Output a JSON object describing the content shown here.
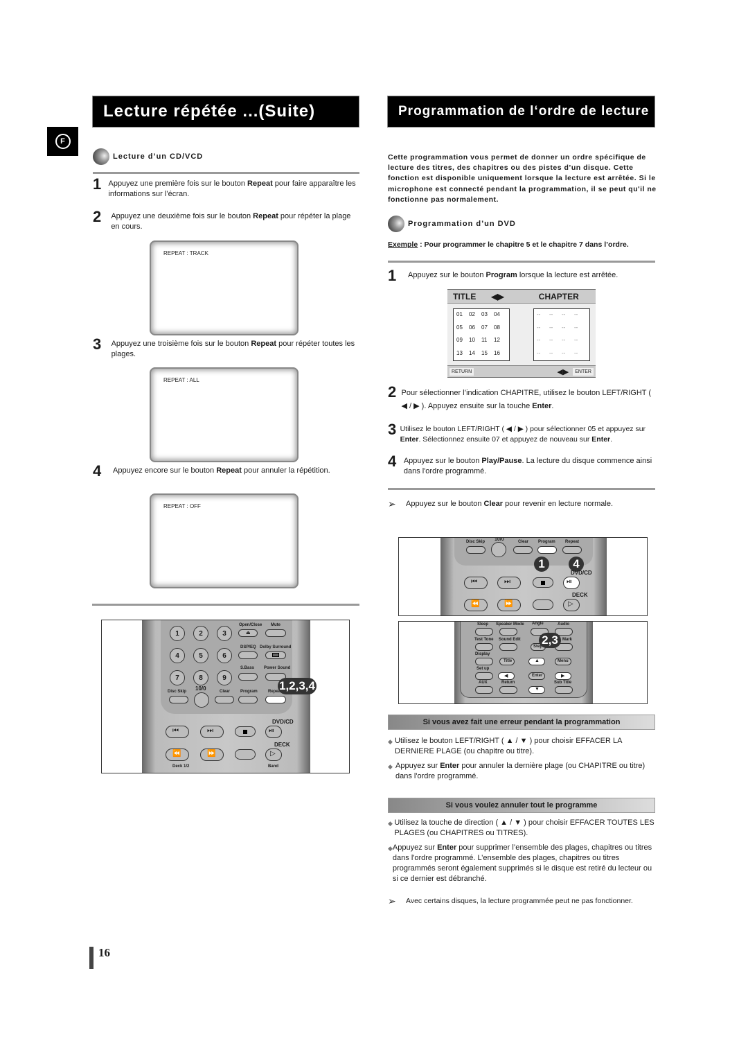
{
  "left": {
    "title": "Lecture répétée ...(Suite)",
    "lang_badge": "F",
    "subhead": "Lecture d’un CD/VCD",
    "steps": [
      {
        "num": "1",
        "pre": "Appuyez une première fois sur le bouton ",
        "bold": "Repeat",
        "post": " pour faire apparaître les informations sur l’écran."
      },
      {
        "num": "2",
        "pre": "Appuyez une deuxième fois sur le bouton ",
        "bold": "Repeat",
        "post": " pour répéter la plage en cours."
      },
      {
        "num": "3",
        "pre": "Appuyez une troisième fois sur le bouton ",
        "bold": "Repeat",
        "post": " pour répéter toutes les plages."
      },
      {
        "num": "4",
        "pre": "Appuyez encore sur le bouton ",
        "bold": "Repeat",
        "post": " pour annuler la répétition."
      }
    ],
    "screens": [
      "REPEAT : TRACK",
      "REPEAT : ALL",
      "REPEAT : OFF"
    ],
    "remote": {
      "numbers": [
        "1",
        "2",
        "3",
        "4",
        "5",
        "6",
        "7",
        "8",
        "9"
      ],
      "labels": {
        "open_close": "Open/Close",
        "mute": "Mute",
        "dsp_eq": "DSP/EQ",
        "dolby": "Dolby Surround",
        "sbass": "S.Bass",
        "power_sound": "Power Sound",
        "disc_skip": "Disc Skip",
        "ten": "10/0",
        "clear": "Clear",
        "program": "Program",
        "repeat": "Repeat",
        "dvd_cd": "DVD/CD",
        "deck": "DECK",
        "deck12": "Deck 1/2",
        "band": "Band"
      },
      "badge": "1,2,3,4"
    }
  },
  "right": {
    "title": "Programmation de l‘ordre de lecture",
    "intro": "Cette programmation vous permet de donner un ordre spécifique de lecture des titres, des chapitres ou des pistes d’un disque. Cette fonction est disponible uniquement lorsque la lecture est arrêtée. Si le microphone est connecté pendant la programmation, il se peut qu'il ne fonctionne pas normalement.",
    "subhead": "Programmation d’un DVD",
    "example_label": "Exemple",
    "example_text": " : Pour programmer le chapitre 5 et le chapitre 7 dans l’ordre.",
    "step1": {
      "num": "1",
      "pre": "Appuyez sur le bouton ",
      "bold": "Program",
      "post": " lorsque la lecture est arrêtée."
    },
    "menu": {
      "title": "TITLE",
      "chapter": "CHAPTER",
      "arrows": "◀▶",
      "titles": [
        "01",
        "02",
        "03",
        "04",
        "05",
        "06",
        "07",
        "08",
        "09",
        "10",
        "11",
        "12",
        "13",
        "14",
        "15",
        "16"
      ],
      "chapters": [
        "--",
        "--",
        "--",
        "--",
        "--",
        "--",
        "--",
        "--",
        "--",
        "--",
        "--",
        "--",
        "--",
        "--",
        "--",
        "--"
      ],
      "return": "RETURN",
      "enter": "ENTER"
    },
    "step2": {
      "num": "2",
      "a": "Pour sélectionner l’indication CHAPITRE, utilisez le bouton LEFT/RIGHT ( ◀ / ▶ ). Appuyez ensuite sur la touche ",
      "b": "Enter",
      "c": "."
    },
    "step3": {
      "num": "3",
      "a": "Utilisez le bouton LEFT/RIGHT ( ◀ / ▶ ) pour sélectionner 05 et appuyez sur ",
      "b": "Enter",
      "c": ". Sélectionnez ensuite 07 et appuyez de nouveau sur ",
      "d": "Enter",
      "e": "."
    },
    "step4": {
      "num": "4",
      "a": "Appuyez sur le bouton ",
      "b": "Play/Pause",
      "c": ". La lecture du disque commence ainsi dans l'ordre programmé."
    },
    "note1": {
      "a": "Appuyez sur le bouton ",
      "b": "Clear",
      "c": " pour revenir en lecture normale."
    },
    "remote_top": {
      "disc_skip": "Disc Skip",
      "ten": "10/0",
      "clear": "Clear",
      "program": "Program",
      "repeat": "Repeat",
      "dvd_cd": "DVD/CD",
      "deck": "DECK",
      "badge1": "1",
      "badge4": "4"
    },
    "remote_bottom": {
      "sleep": "Sleep",
      "speaker": "Speaker Mode",
      "angle": "Angle",
      "audio": "Audio",
      "test": "Test Tone",
      "sound_edit": "Sound Edit",
      "mark": "Mark",
      "display": "Display",
      "title": "Title",
      "menu": "Menu",
      "setup": "Set up",
      "enter": "Enter",
      "aux": "AUX",
      "return": "Return",
      "subtitle": "Sub Title",
      "step": "Step",
      "badge": "2,3"
    },
    "banner1": "Si vous avez fait une erreur pendant la programmation",
    "err1": "Utilisez le bouton LEFT/RIGHT ( ▲ / ▼ ) pour choisir EFFACER LA DERNIERE PLAGE (ou chapitre ou titre).",
    "err2": {
      "a": "Appuyez sur ",
      "b": "Enter",
      "c": " pour annuler la dernière plage (ou CHAPITRE ou titre) dans l'ordre programmé."
    },
    "banner2": "Si vous voulez annuler tout le programme",
    "all1": "Utilisez la touche de direction ( ▲ / ▼ ) pour choisir EFFACER TOUTES LES PLAGES (ou CHAPITRES ou TITRES).",
    "all2": {
      "a": "Appuyez sur ",
      "b": "Enter",
      "c": " pour supprimer l’ensemble des plages, chapitres ou titres dans l'ordre programmé. L’ensemble des plages, chapitres ou titres programmés seront également supprimés si le disque est retiré du lecteur ou si ce dernier est débranché."
    },
    "note2": "Avec certains disques, la lecture programmée peut ne pas fonctionner."
  },
  "page_number": "16"
}
